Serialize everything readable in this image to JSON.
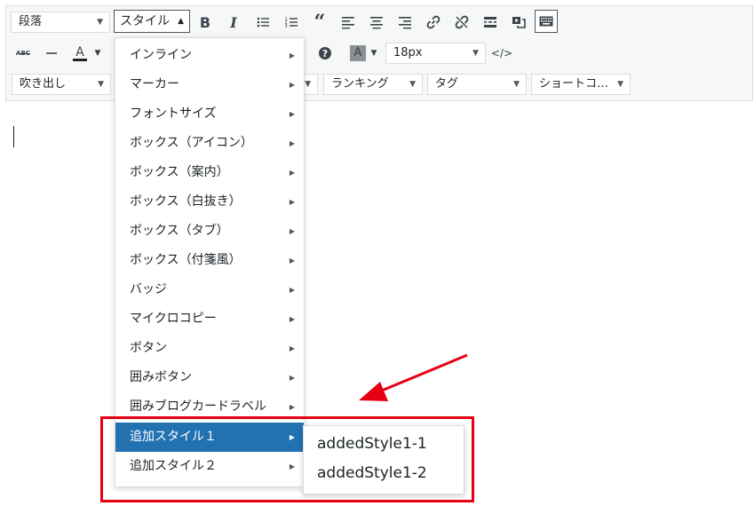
{
  "toolbar": {
    "format_select": "段落",
    "style_button": "スタイル",
    "fontsize_select": "18px",
    "row3": {
      "fukidashi": "吹き出し",
      "ranking": "ランキング",
      "tag": "タグ",
      "shortcode": "ショートコ…"
    },
    "text_color_letter": "A",
    "bg_color_letter": "A",
    "strike_text": "ABC"
  },
  "style_menu": {
    "items": [
      {
        "label": "インライン"
      },
      {
        "label": "マーカー"
      },
      {
        "label": "フォントサイズ"
      },
      {
        "label": "ボックス（アイコン）"
      },
      {
        "label": "ボックス（案内）"
      },
      {
        "label": "ボックス（白抜き）"
      },
      {
        "label": "ボックス（タブ）"
      },
      {
        "label": "ボックス（付箋風）"
      },
      {
        "label": "バッジ"
      },
      {
        "label": "マイクロコピー"
      },
      {
        "label": "ボタン"
      },
      {
        "label": "囲みボタン"
      },
      {
        "label": "囲みブログカードラベル"
      },
      {
        "label": "追加スタイル１"
      },
      {
        "label": "追加スタイル２"
      }
    ],
    "active_index": 13
  },
  "submenu": {
    "items": [
      {
        "label": "addedStyle1-1"
      },
      {
        "label": "addedStyle1-2"
      }
    ]
  },
  "colors": {
    "highlight": "#2271b1",
    "annotation": "#e60012"
  }
}
